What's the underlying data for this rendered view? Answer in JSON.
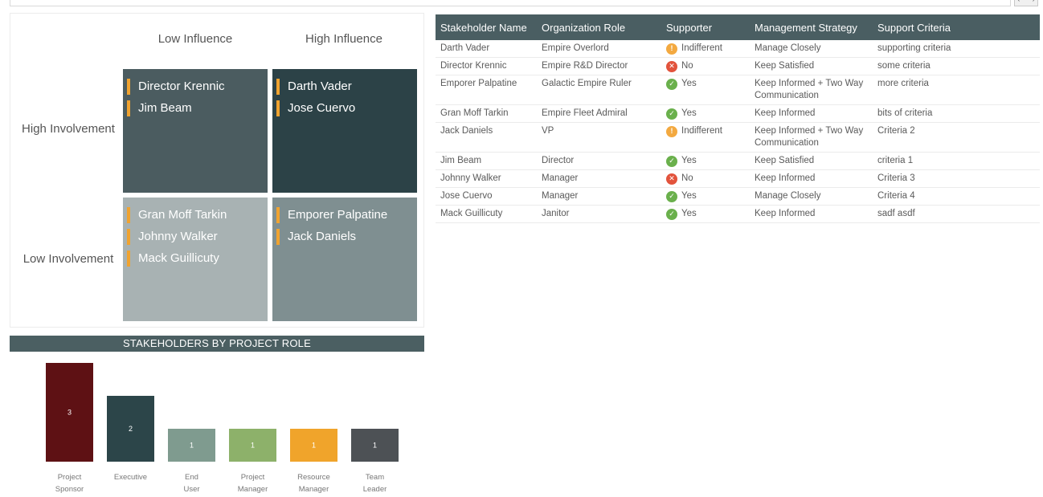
{
  "matrix": {
    "influence_low": "Low Influence",
    "influence_high": "High Influence",
    "involvement_high": "High Involvement",
    "involvement_low": "Low Involvement",
    "quadrants": {
      "high_involvement_low_influence": [
        "Director Krennic",
        "Jim Beam"
      ],
      "high_involvement_high_influence": [
        "Darth Vader",
        "Jose Cuervo"
      ],
      "low_involvement_low_influence": [
        "Gran Moff Tarkin",
        "Johnny Walker",
        "Mack Guillicuty"
      ],
      "low_involvement_high_influence": [
        "Emporer Palpatine",
        "Jack Daniels"
      ]
    }
  },
  "chart_data": {
    "type": "bar",
    "title": "STAKEHOLDERS BY PROJECT ROLE",
    "categories": [
      "Project Sponsor",
      "Executive",
      "End User",
      "Project Manager",
      "Resource Manager",
      "Team Leader"
    ],
    "values": [
      3,
      2,
      1,
      1,
      1,
      1
    ],
    "colors": [
      "#5e1114",
      "#2c4549",
      "#7f9b8f",
      "#8db16a",
      "#f0a42b",
      "#4d5155"
    ],
    "ylim": [
      0,
      3
    ]
  },
  "table": {
    "headers": [
      "Stakeholder Name",
      "Organization Role",
      "Supporter",
      "Management Strategy",
      "Support Criteria"
    ],
    "rows": [
      {
        "name": "Darth Vader",
        "role": "Empire Overlord",
        "supporter": "Indifferent",
        "strategy": "Manage Closely",
        "criteria": "supporting criteria"
      },
      {
        "name": "Director Krennic",
        "role": "Empire R&D Director",
        "supporter": "No",
        "strategy": "Keep Satisfied",
        "criteria": "some criteria"
      },
      {
        "name": "Emporer Palpatine",
        "role": "Galactic Empire Ruler",
        "supporter": "Yes",
        "strategy": "Keep Informed + Two Way Communication",
        "criteria": "more criteria"
      },
      {
        "name": "Gran Moff Tarkin",
        "role": "Empire Fleet Admiral",
        "supporter": "Yes",
        "strategy": "Keep Informed",
        "criteria": "bits of criteria"
      },
      {
        "name": "Jack Daniels",
        "role": "VP",
        "supporter": "Indifferent",
        "strategy": "Keep Informed + Two Way Communication",
        "criteria": "Criteria 2"
      },
      {
        "name": "Jim Beam",
        "role": "Director",
        "supporter": "Yes",
        "strategy": "Keep Satisfied",
        "criteria": "criteria 1"
      },
      {
        "name": "Johnny Walker",
        "role": "Manager",
        "supporter": "No",
        "strategy": "Keep Informed",
        "criteria": "Criteria 3"
      },
      {
        "name": "Jose Cuervo",
        "role": "Manager",
        "supporter": "Yes",
        "strategy": "Manage Closely",
        "criteria": "Criteria 4"
      },
      {
        "name": "Mack Guillicuty",
        "role": "Janitor",
        "supporter": "Yes",
        "strategy": "Keep Informed",
        "criteria": "sadf asdf"
      }
    ]
  },
  "icons": {
    "yes": "check-circle-icon",
    "no": "x-circle-icon",
    "indifferent": "exclamation-circle-icon"
  }
}
